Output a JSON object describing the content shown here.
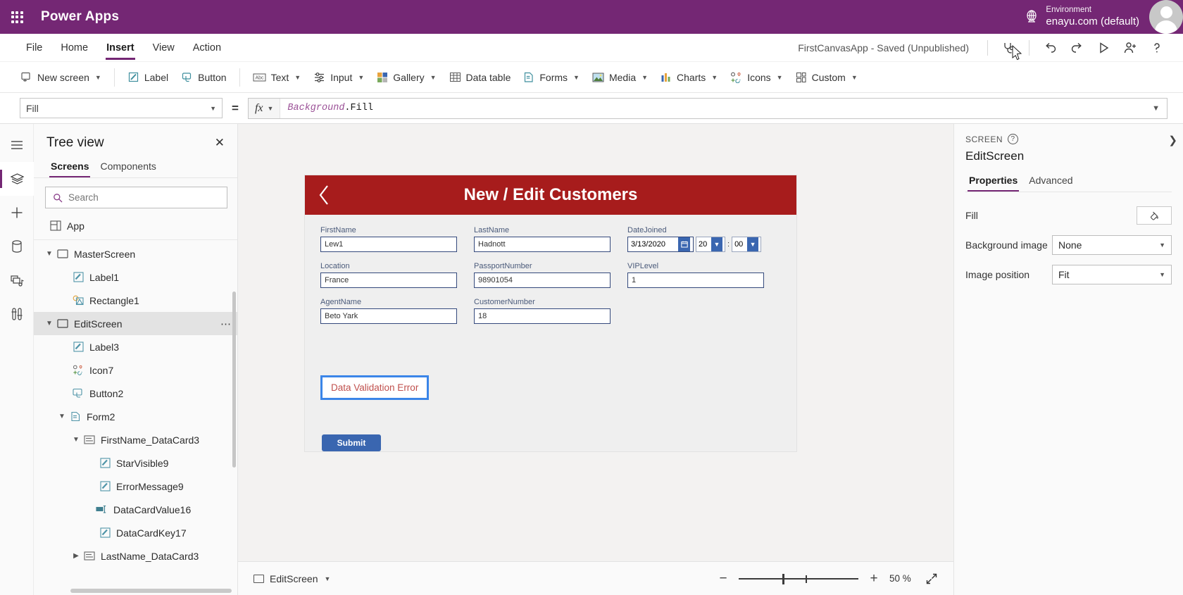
{
  "topbar": {
    "brand": "Power Apps",
    "waffle_icon": "app-launcher-icon",
    "environment_label": "Environment",
    "environment_value": "enayu.com (default)",
    "environment_icon": "globe-icon",
    "avatar_icon": "user-avatar"
  },
  "menubar": {
    "items": [
      {
        "label": "File",
        "active": false
      },
      {
        "label": "Home",
        "active": false
      },
      {
        "label": "Insert",
        "active": true
      },
      {
        "label": "View",
        "active": false
      },
      {
        "label": "Action",
        "active": false
      }
    ],
    "app_status": "FirstCanvasApp - Saved (Unpublished)",
    "actions": [
      {
        "name": "app-checker-icon",
        "label": "App checker"
      },
      {
        "name": "undo-icon",
        "label": "Undo"
      },
      {
        "name": "redo-icon",
        "label": "Redo"
      },
      {
        "name": "preview-play-icon",
        "label": "Preview the app"
      },
      {
        "name": "share-user-icon",
        "label": "Share"
      },
      {
        "name": "help-icon",
        "label": "Help"
      }
    ]
  },
  "ribbon": {
    "items": [
      {
        "label": "New screen",
        "icon": "new-screen-icon",
        "caret": true
      },
      {
        "label": "Label",
        "icon": "label-icon",
        "caret": false
      },
      {
        "label": "Button",
        "icon": "button-icon",
        "caret": false
      },
      {
        "label": "Text",
        "icon": "text-abc-icon",
        "caret": true
      },
      {
        "label": "Input",
        "icon": "input-sliders-icon",
        "caret": true
      },
      {
        "label": "Gallery",
        "icon": "gallery-icon",
        "caret": true
      },
      {
        "label": "Data table",
        "icon": "data-table-icon",
        "caret": false
      },
      {
        "label": "Forms",
        "icon": "forms-icon",
        "caret": true
      },
      {
        "label": "Media",
        "icon": "media-image-icon",
        "caret": true
      },
      {
        "label": "Charts",
        "icon": "charts-bar-icon",
        "caret": true
      },
      {
        "label": "Icons",
        "icon": "icons-shapes-icon",
        "caret": true
      },
      {
        "label": "Custom",
        "icon": "custom-blocks-icon",
        "caret": true
      }
    ]
  },
  "formula_bar": {
    "property": "Fill",
    "equals": "=",
    "fx_symbol": "fx",
    "formula_object": "Background",
    "formula_member": ".Fill"
  },
  "rail": {
    "items": [
      {
        "name": "hamburger-menu-icon",
        "selected": false
      },
      {
        "name": "tree-view-layers-icon",
        "selected": true
      },
      {
        "name": "insert-plus-icon",
        "selected": false
      },
      {
        "name": "data-cylinder-icon",
        "selected": false
      },
      {
        "name": "media-library-icon",
        "selected": false
      },
      {
        "name": "advanced-tools-icon",
        "selected": false
      }
    ]
  },
  "tree": {
    "title": "Tree view",
    "close_icon": "close-icon",
    "tabs": [
      {
        "label": "Screens",
        "active": true
      },
      {
        "label": "Components",
        "active": false
      }
    ],
    "search_placeholder": "Search",
    "search_icon": "search-icon",
    "nodes": [
      {
        "label": "App",
        "icon": "app-icon",
        "indent": 0,
        "chevron": "",
        "selected": false,
        "ellipsis": false
      },
      {
        "label": "MasterScreen",
        "icon": "screen-icon",
        "indent": 0,
        "chevron": "v",
        "selected": false,
        "ellipsis": false
      },
      {
        "label": "Label1",
        "icon": "label-pencil-icon",
        "indent": 1,
        "chevron": "",
        "selected": false,
        "ellipsis": false
      },
      {
        "label": "Rectangle1",
        "icon": "rectangle-shape-icon",
        "indent": 1,
        "chevron": "",
        "selected": false,
        "ellipsis": false
      },
      {
        "label": "EditScreen",
        "icon": "screen-icon",
        "indent": 0,
        "chevron": "v",
        "selected": true,
        "ellipsis": true
      },
      {
        "label": "Label3",
        "icon": "label-pencil-icon",
        "indent": 1,
        "chevron": "",
        "selected": false,
        "ellipsis": false
      },
      {
        "label": "Icon7",
        "icon": "icon-shapes-icon",
        "indent": 1,
        "chevron": "",
        "selected": false,
        "ellipsis": false
      },
      {
        "label": "Button2",
        "icon": "button-icon",
        "indent": 1,
        "chevron": "",
        "selected": false,
        "ellipsis": false
      },
      {
        "label": "Form2",
        "icon": "form-icon",
        "indent": 1,
        "chevron": "v",
        "selected": false,
        "ellipsis": false
      },
      {
        "label": "FirstName_DataCard3",
        "icon": "datacard-icon",
        "indent": 2,
        "chevron": "v",
        "selected": false,
        "ellipsis": false
      },
      {
        "label": "StarVisible9",
        "icon": "label-pencil-icon",
        "indent": 3,
        "chevron": "",
        "selected": false,
        "ellipsis": false
      },
      {
        "label": "ErrorMessage9",
        "icon": "label-pencil-icon",
        "indent": 3,
        "chevron": "",
        "selected": false,
        "ellipsis": false
      },
      {
        "label": "DataCardValue16",
        "icon": "textinput-icon",
        "indent": 3,
        "chevron": "",
        "selected": false,
        "ellipsis": false
      },
      {
        "label": "DataCardKey17",
        "icon": "label-pencil-icon",
        "indent": 3,
        "chevron": "",
        "selected": false,
        "ellipsis": false
      },
      {
        "label": "LastName_DataCard3",
        "icon": "datacard-icon",
        "indent": 2,
        "chevron": ">",
        "selected": false,
        "ellipsis": false
      }
    ]
  },
  "canvas": {
    "screen_header_title": "New / Edit Customers",
    "back_icon": "chevron-left-icon",
    "header_color": "#a71c1c",
    "fields": [
      {
        "label": "FirstName",
        "value": "Lew1",
        "type": "text"
      },
      {
        "label": "LastName",
        "value": "Hadnott",
        "type": "text"
      },
      {
        "label": "DateJoined",
        "value": "3/13/2020",
        "type": "date",
        "hour": "20",
        "minute": "00"
      },
      {
        "label": "Location",
        "value": "France",
        "type": "text"
      },
      {
        "label": "PassportNumber",
        "value": "98901054",
        "type": "text"
      },
      {
        "label": "VIPLevel",
        "value": "1",
        "type": "text"
      },
      {
        "label": "AgentName",
        "value": "Beto Yark",
        "type": "text"
      },
      {
        "label": "CustomerNumber",
        "value": "18",
        "type": "text"
      }
    ],
    "error_label": "Data Validation Error",
    "error_text_color": "#c0504d",
    "selection_color": "#3b85e8",
    "submit_label": "Submit",
    "submit_color": "#3a66b0"
  },
  "statusbar": {
    "screen_name": "EditScreen",
    "screen_icon": "screen-icon",
    "caret_icon": "chevron-down-icon",
    "zoom_out_icon": "minus-icon",
    "zoom_in_icon": "plus-icon",
    "zoom_value": "50",
    "zoom_unit": "%",
    "fit_icon": "fit-screen-icon"
  },
  "props": {
    "kind": "SCREEN",
    "help_icon": "help-circle-icon",
    "name": "EditScreen",
    "collapse_icon": "chevron-right-icon",
    "tabs": [
      {
        "label": "Properties",
        "active": true
      },
      {
        "label": "Advanced",
        "active": false
      }
    ],
    "rows": [
      {
        "label": "Fill",
        "type": "color",
        "value": ""
      },
      {
        "label": "Background image",
        "type": "dropdown",
        "value": "None"
      },
      {
        "label": "Image position",
        "type": "dropdown",
        "value": "Fit"
      }
    ]
  },
  "colors": {
    "brand_purple": "#742774",
    "accent_red": "#a71c1c",
    "accent_blue": "#3a66b0",
    "selection_blue": "#3b85e8"
  }
}
